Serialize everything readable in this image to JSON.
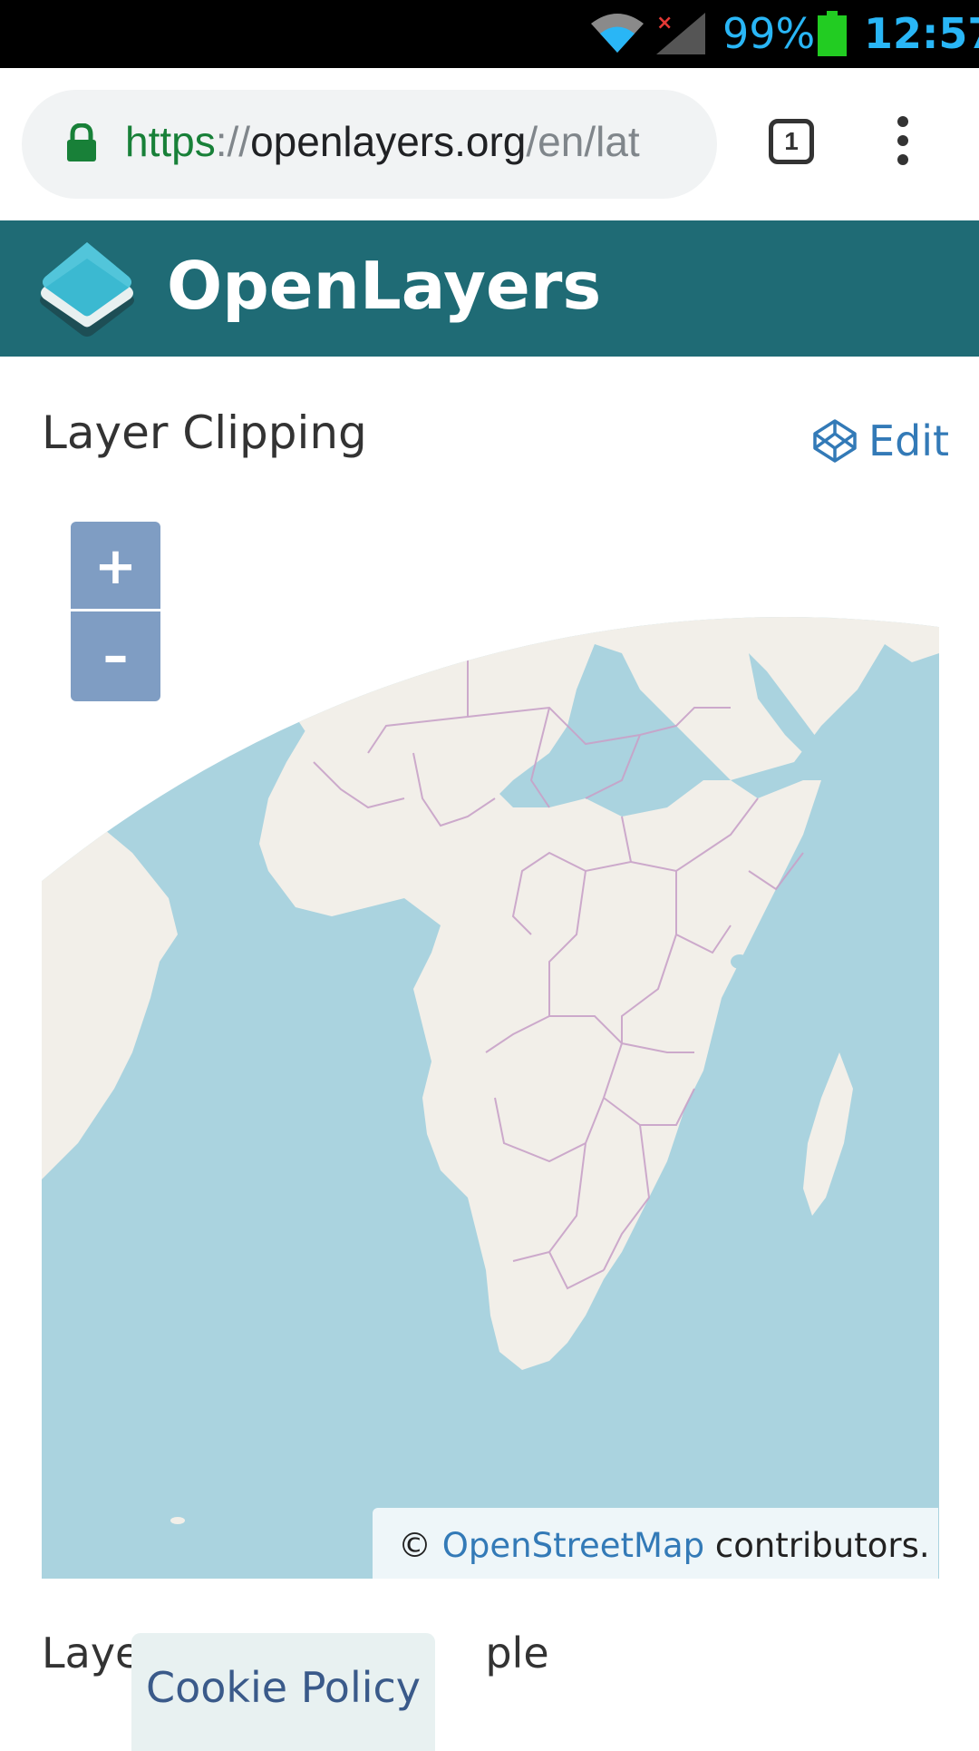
{
  "status_bar": {
    "battery_percent": "99%",
    "time": "12:57",
    "icons": [
      "wifi-icon",
      "no-signal-icon",
      "battery-icon"
    ],
    "accent_color": "#29b6f6"
  },
  "browser": {
    "url": {
      "scheme": "https",
      "separator": "://",
      "host": "openlayers.org",
      "path": "/en/lat"
    },
    "tab_count": "1",
    "icons": [
      "lock-icon",
      "tabs-icon",
      "more-menu-icon"
    ]
  },
  "header": {
    "title": "OpenLayers",
    "background_color": "#1f6b75"
  },
  "example": {
    "title": "Layer Clipping",
    "edit_label": "Edit",
    "edit_icon": "codepen-icon"
  },
  "map": {
    "zoom_in_label": "+",
    "zoom_out_label": "–",
    "attribution": {
      "prefix": "©",
      "link": "OpenStreetMap",
      "suffix": "contributors."
    },
    "ocean_color": "#aad3df",
    "land_color": "#f2efe9",
    "border_color": "#c8a2c8"
  },
  "below": {
    "section_title_partial": "Laye",
    "section_title_end": "ple",
    "cookie_label": "Cookie Policy"
  }
}
